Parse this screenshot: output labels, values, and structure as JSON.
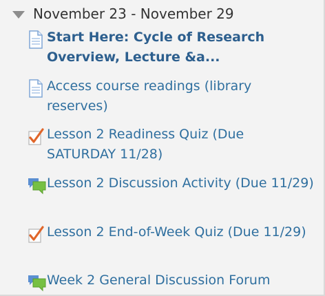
{
  "section": {
    "title": "November 23 - November 29"
  },
  "items": [
    {
      "icon": "page-icon",
      "label": "Start Here: Cycle of Research Overview, Lecture &a...",
      "bold": true
    },
    {
      "icon": "page-icon",
      "label": "Access course readings (library reserves)",
      "bold": false
    },
    {
      "icon": "quiz-icon",
      "label": "Lesson 2 Readiness Quiz (Due SATURDAY 11/28)",
      "bold": false
    },
    {
      "icon": "forum-icon",
      "label": "Lesson 2 Discussion Activity (Due 11/29)",
      "bold": false
    },
    {
      "icon": "quiz-icon",
      "label": "Lesson 2 End-of-Week Quiz (Due 11/29)",
      "bold": false
    },
    {
      "icon": "forum-icon",
      "label": "Week 2 General Discussion Forum",
      "bold": false
    }
  ],
  "colors": {
    "link": "#2f6f9f",
    "quiz_check": "#e0662a",
    "forum_green": "#76c043",
    "forum_blue": "#5b8fd1",
    "page_blue": "#7fa6d6"
  }
}
